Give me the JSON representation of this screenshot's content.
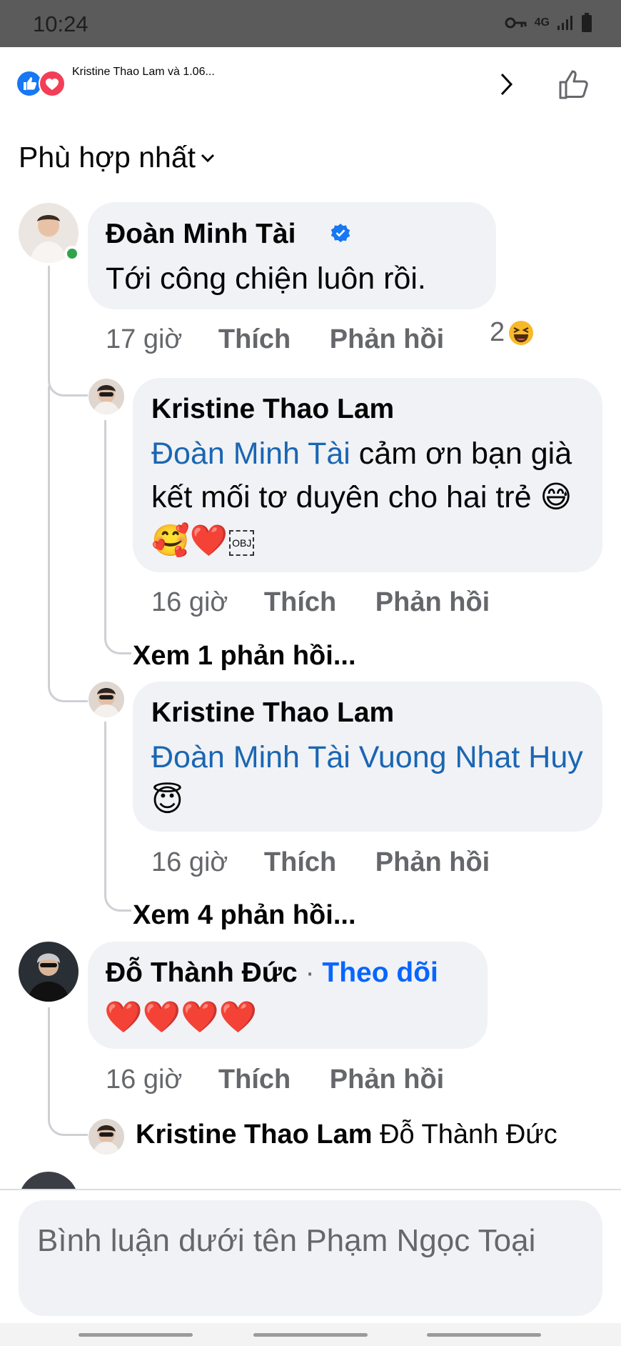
{
  "status_bar": {
    "time": "10:24",
    "network": "4G"
  },
  "header": {
    "title": "Kristine Thao Lam và 1.06...",
    "reaction_icons": [
      "like-icon",
      "love-icon"
    ],
    "brand_color": "#0866ff"
  },
  "sort": {
    "label": "Phù hợp nhất"
  },
  "comments": [
    {
      "author": "Đoàn Minh Tài",
      "verified": true,
      "text": "Tới công chiện luôn rồi.",
      "time": "17 giờ",
      "like": "Thích",
      "reply": "Phản hồi",
      "reaction_count": "2",
      "reaction_icon": "haha-icon",
      "replies": [
        {
          "author": "Kristine Thao Lam",
          "mention": "Đoàn Minh Tài",
          "text": " cảm ơn bạn già kết mối tơ duyên cho hai trẻ ",
          "emojis": "😅🥰❤️",
          "obj": "OBJ",
          "time": "16 giờ",
          "like": "Thích",
          "reply": "Phản hồi",
          "more": "Xem 1 phản hồi..."
        },
        {
          "author": "Kristine Thao Lam",
          "mention": "Đoàn Minh Tài Vuong Nhat Huy",
          "text": "",
          "emojis": "😇",
          "time": "16 giờ",
          "like": "Thích",
          "reply": "Phản hồi",
          "more": "Xem 4 phản hồi..."
        }
      ]
    },
    {
      "author": "Đỗ Thành Đức",
      "follow": "Theo dõi",
      "text": "❤️❤️❤️❤️",
      "time": "16 giờ",
      "like": "Thích",
      "reply": "Phản hồi",
      "reply_preview": {
        "author": "Kristine Thao Lam",
        "text": "Đỗ Thành Đức"
      }
    }
  ],
  "composer": {
    "placeholder": "Bình luận dưới tên Phạm Ngọc Toại"
  }
}
